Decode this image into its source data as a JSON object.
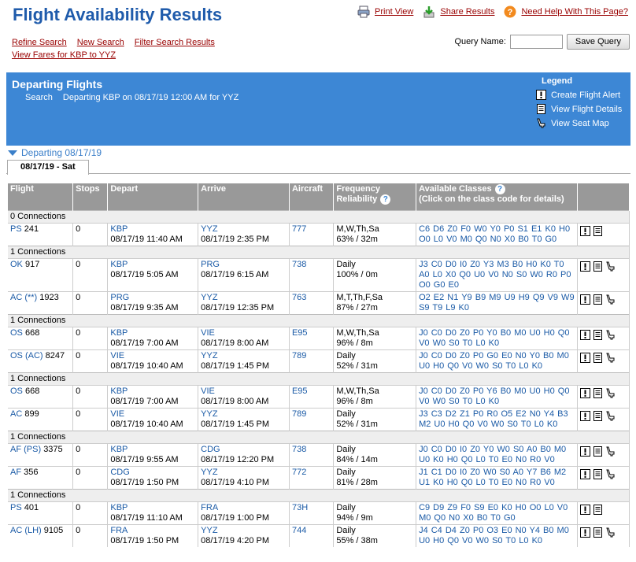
{
  "header": {
    "title": "Flight Availability Results",
    "print_view": "Print View",
    "share_results": "Share Results",
    "need_help": "Need Help With This Page?",
    "refine_search": "Refine Search",
    "new_search": "New Search",
    "filter_results": "Filter Search Results",
    "view_fares": "View Fares for KBP to YYZ",
    "query_name_label": "Query Name:",
    "query_name_value": "",
    "save_query": "Save Query"
  },
  "banner": {
    "title": "Departing Flights",
    "search_label": "Search",
    "search_text": "Departing KBP on 08/17/19 12:00 AM for YYZ",
    "legend_title": "Legend",
    "legend_items": [
      "Create Flight Alert",
      "View Flight Details",
      "View Seat Map"
    ]
  },
  "section": {
    "heading": "Departing 08/17/19",
    "tab": "08/17/19 - Sat"
  },
  "table": {
    "headers": [
      "Flight",
      "Stops",
      "Depart",
      "Arrive",
      "Aircraft",
      "Frequency",
      "Reliability",
      "Available Classes",
      "(Click on the class code for details)"
    ],
    "groups": [
      {
        "label": "0 Connections",
        "flights": [
          {
            "carrier": "PS",
            "num": "241",
            "stops": "0",
            "dep": "KBP",
            "dep_time": "08/17/19 11:40 AM",
            "arr": "YYZ",
            "arr_time": "08/17/19 2:35 PM",
            "aircraft": "777",
            "freq": "M,W,Th,Sa",
            "rel": "63% / 32m",
            "classes": "C6 D6 Z0 F0 W0 Y0 P0 S1 E1 K0 H0 O0 L0 V0 M0 Q0 N0 X0 B0 T0 G0",
            "seat": false
          }
        ]
      },
      {
        "label": "1 Connections",
        "flights": [
          {
            "carrier": "OK",
            "num": "917",
            "stops": "0",
            "dep": "KBP",
            "dep_time": "08/17/19 5:05 AM",
            "arr": "PRG",
            "arr_time": "08/17/19 6:15 AM",
            "aircraft": "738",
            "freq": "Daily",
            "rel": "100% / 0m",
            "classes": "J3 C0 D0 I0 Z0 Y3 M3 B0 H0 K0 T0 A0 L0 X0 Q0 U0 V0 N0 S0 W0 R0 P0 O0 G0 E0",
            "seat": true
          },
          {
            "carrier": "AC (**)",
            "num": "1923",
            "stops": "0",
            "dep": "PRG",
            "dep_time": "08/17/19 9:35 AM",
            "arr": "YYZ",
            "arr_time": "08/17/19 12:35 PM",
            "aircraft": "763",
            "freq": "M,T,Th,F,Sa",
            "rel": "87% / 27m",
            "classes": "O2 E2 N1 Y9 B9 M9 U9 H9 Q9 V9 W9 S9 T9 L9 K0",
            "seat": true
          }
        ]
      },
      {
        "label": "1 Connections",
        "flights": [
          {
            "carrier": "OS",
            "num": "668",
            "stops": "0",
            "dep": "KBP",
            "dep_time": "08/17/19 7:00 AM",
            "arr": "VIE",
            "arr_time": "08/17/19 8:00 AM",
            "aircraft": "E95",
            "freq": "M,W,Th,Sa",
            "rel": "96% / 8m",
            "classes": "J0 C0 D0 Z0 P0 Y0 B0 M0 U0 H0 Q0 V0 W0 S0 T0 L0 K0",
            "seat": true
          },
          {
            "carrier": "OS (AC)",
            "num": "8247",
            "stops": "0",
            "dep": "VIE",
            "dep_time": "08/17/19 10:40 AM",
            "arr": "YYZ",
            "arr_time": "08/17/19 1:45 PM",
            "aircraft": "789",
            "freq": "Daily",
            "rel": "52% / 31m",
            "classes": "J0 C0 D0 Z0 P0 G0 E0 N0 Y0 B0 M0 U0 H0 Q0 V0 W0 S0 T0 L0 K0",
            "seat": true
          }
        ]
      },
      {
        "label": "1 Connections",
        "flights": [
          {
            "carrier": "OS",
            "num": "668",
            "stops": "0",
            "dep": "KBP",
            "dep_time": "08/17/19 7:00 AM",
            "arr": "VIE",
            "arr_time": "08/17/19 8:00 AM",
            "aircraft": "E95",
            "freq": "M,W,Th,Sa",
            "rel": "96% / 8m",
            "classes": "J0 C0 D0 Z0 P0 Y6 B0 M0 U0 H0 Q0 V0 W0 S0 T0 L0 K0",
            "seat": true
          },
          {
            "carrier": "AC",
            "num": "899",
            "stops": "0",
            "dep": "VIE",
            "dep_time": "08/17/19 10:40 AM",
            "arr": "YYZ",
            "arr_time": "08/17/19 1:45 PM",
            "aircraft": "789",
            "freq": "Daily",
            "rel": "52% / 31m",
            "classes": "J3 C3 D2 Z1 P0 R0 O5 E2 N0 Y4 B3 M2 U0 H0 Q0 V0 W0 S0 T0 L0 K0",
            "seat": true
          }
        ]
      },
      {
        "label": "1 Connections",
        "flights": [
          {
            "carrier": "AF (PS)",
            "num": "3375",
            "stops": "0",
            "dep": "KBP",
            "dep_time": "08/17/19 9:55 AM",
            "arr": "CDG",
            "arr_time": "08/17/19 12:20 PM",
            "aircraft": "738",
            "freq": "Daily",
            "rel": "84% / 14m",
            "classes": "J0 C0 D0 I0 Z0 Y0 W0 S0 A0 B0 M0 U0 K0 H0 Q0 L0 T0 E0 N0 R0 V0",
            "seat": true
          },
          {
            "carrier": "AF",
            "num": "356",
            "stops": "0",
            "dep": "CDG",
            "dep_time": "08/17/19 1:50 PM",
            "arr": "YYZ",
            "arr_time": "08/17/19 4:10 PM",
            "aircraft": "772",
            "freq": "Daily",
            "rel": "81% / 28m",
            "classes": "J1 C1 D0 I0 Z0 W0 S0 A0 Y7 B6 M2 U1 K0 H0 Q0 L0 T0 E0 N0 R0 V0",
            "seat": true
          }
        ]
      },
      {
        "label": "1 Connections",
        "flights": [
          {
            "carrier": "PS",
            "num": "401",
            "stops": "0",
            "dep": "KBP",
            "dep_time": "08/17/19 11:10 AM",
            "arr": "FRA",
            "arr_time": "08/17/19 1:00 PM",
            "aircraft": "73H",
            "freq": "Daily",
            "rel": "94% / 9m",
            "classes": "C9 D9 Z9 F0 S9 E0 K0 H0 O0 L0 V0 M0 Q0 N0 X0 B0 T0 G0",
            "seat": false
          },
          {
            "carrier": "AC (LH)",
            "num": "9105",
            "stops": "0",
            "dep": "FRA",
            "dep_time": "08/17/19 1:50 PM",
            "arr": "YYZ",
            "arr_time": "08/17/19 4:20 PM",
            "aircraft": "744",
            "freq": "Daily",
            "rel": "55% / 38m",
            "classes": "J4 C4 D4 Z0 P0 O3 E0 N0 Y4 B0 M0 U0 H0 Q0 V0 W0 S0 T0 L0 K0",
            "seat": true
          }
        ]
      }
    ]
  }
}
